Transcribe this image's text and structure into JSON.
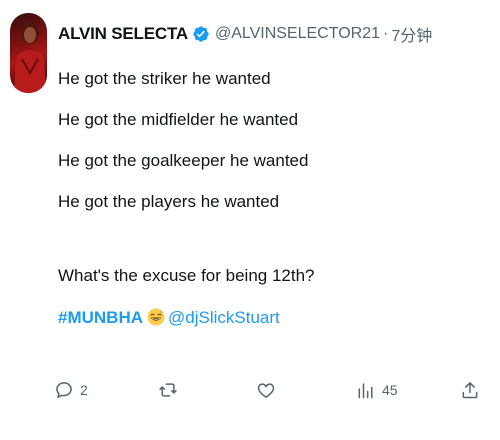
{
  "tweet": {
    "author_name": "ALVIN SELECTA",
    "handle": "@ALVINSELECTOR21",
    "separator": "·",
    "time": "7分钟",
    "lines": [
      "He got the striker he wanted",
      "He got the midfielder he wanted",
      "He got the goalkeeper he wanted",
      "He got the players he wanted",
      "What's the excuse for being 12th?"
    ],
    "hashtag": "#MUNBHA",
    "emoji": "grinning-sweat-emoji",
    "mention": "@djSlickStuart"
  },
  "actions": {
    "reply_count": "2",
    "retweet_count": "",
    "like_count": "",
    "views_count": "45"
  },
  "colors": {
    "accent": "#1d9bf0",
    "text": "#0f1419",
    "muted": "#536471",
    "avatar": "#b31717"
  },
  "icons": [
    "verified-badge-icon",
    "reply-icon",
    "retweet-icon",
    "like-icon",
    "views-icon",
    "share-icon"
  ]
}
